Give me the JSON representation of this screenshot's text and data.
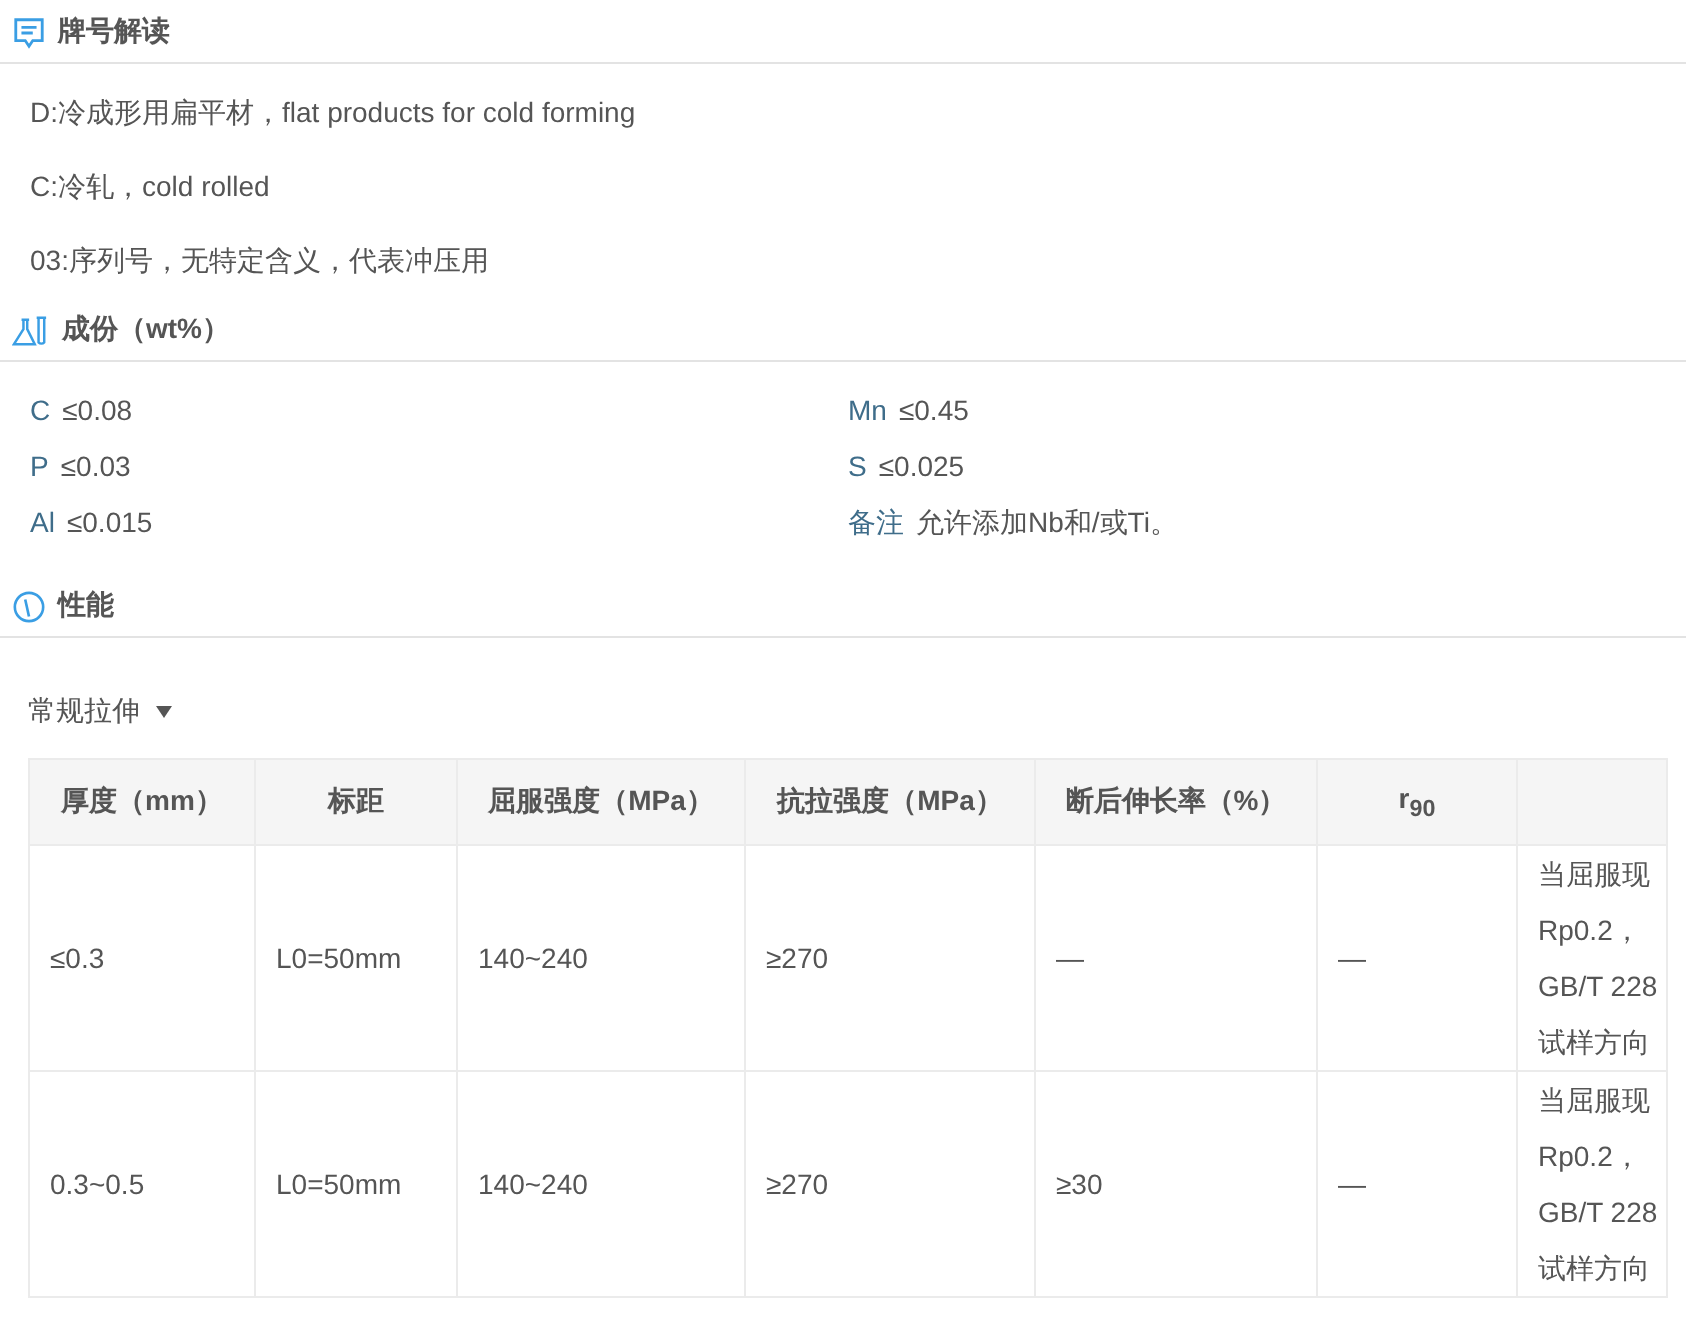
{
  "sections": [
    {
      "kind": "designation",
      "title": "牌号解读",
      "lines": [
        "D:冷成形用扁平材，flat products for cold forming",
        "C:冷轧，cold rolled",
        "03:序列号，无特定含义，代表冲压用"
      ]
    },
    {
      "kind": "composition",
      "title": "成份（wt%）",
      "items": [
        {
          "element": "C",
          "value": "≤0.08"
        },
        {
          "element": "Mn",
          "value": "≤0.45"
        },
        {
          "element": "P",
          "value": "≤0.03"
        },
        {
          "element": "S",
          "value": "≤0.025"
        },
        {
          "element": "Al",
          "value": "≤0.015"
        },
        {
          "element": "备注",
          "value": "允许添加Nb和/或Ti。"
        }
      ]
    },
    {
      "kind": "properties",
      "title": "性能",
      "dropdown": "常规拉伸",
      "table": {
        "columns": [
          "厚度（mm）",
          "标距",
          "屈服强度（MPa）",
          "抗拉强度（MPa）",
          "断后伸长率（%）",
          "r$_{90}$",
          ""
        ],
        "rows": [
          [
            "≤0.3",
            "L0=50mm",
            "140~240",
            "≥270",
            "—",
            "—",
            [
              "当屈服现",
              "Rp0.2，",
              "GB/T 228",
              "试样方向"
            ]
          ],
          [
            "0.3~0.5",
            "L0=50mm",
            "140~240",
            "≥270",
            "≥30",
            "—",
            [
              "当屈服现",
              "Rp0.2，",
              "GB/T 228",
              "试样方向"
            ]
          ]
        ]
      }
    }
  ]
}
